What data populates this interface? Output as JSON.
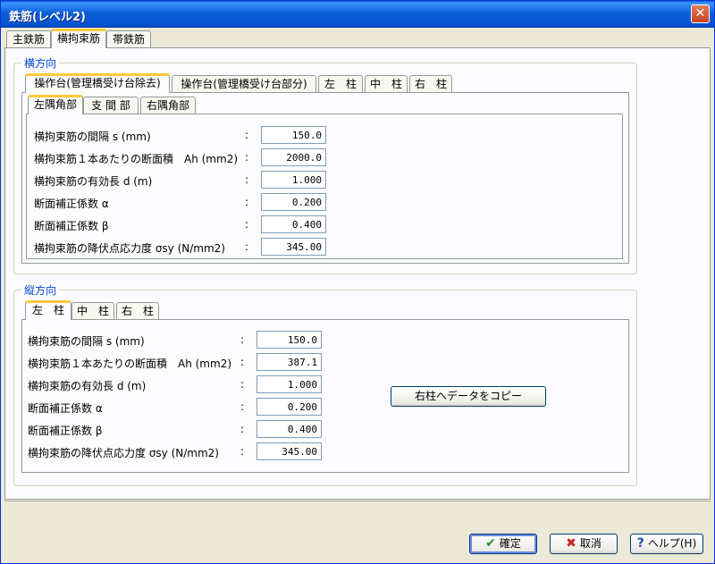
{
  "window": {
    "title": "鉄筋(レベル2)",
    "close_label": "✕"
  },
  "main_tabs": [
    "主鉄筋",
    "横拘束筋",
    "帯鉄筋"
  ],
  "horizontal": {
    "group_label": "横方向",
    "sub_tabs": [
      "操作台(管理橋受け台除去)",
      "操作台(管理橋受け台部分)",
      "左　柱",
      "中　柱",
      "右　柱"
    ],
    "position_tabs": [
      "左隅角部",
      "支 間 部",
      "右隅角部"
    ],
    "rows": [
      {
        "label": "横拘束筋の間隔 s (mm)",
        "value": "150.0"
      },
      {
        "label": "横拘束筋１本あたりの断面積　Ah (mm2)",
        "value": "2000.0"
      },
      {
        "label": "横拘束筋の有効長 d (m)",
        "value": "1.000"
      },
      {
        "label": "断面補正係数 α",
        "value": "0.200"
      },
      {
        "label": "断面補正係数 β",
        "value": "0.400"
      },
      {
        "label": "横拘束筋の降伏点応力度 σsy (N/mm2)",
        "value": "345.00"
      }
    ]
  },
  "vertical": {
    "group_label": "縦方向",
    "sub_tabs": [
      "左　柱",
      "中　柱",
      "右　柱"
    ],
    "rows": [
      {
        "label": "横拘束筋の間隔 s (mm)",
        "value": "150.0"
      },
      {
        "label": "横拘束筋１本あたりの断面積　Ah (mm2)",
        "value": "387.1"
      },
      {
        "label": "横拘束筋の有効長 d (m)",
        "value": "1.000"
      },
      {
        "label": "断面補正係数 α",
        "value": "0.200"
      },
      {
        "label": "断面補正係数 β",
        "value": "0.400"
      },
      {
        "label": "横拘束筋の降伏点応力度 σsy (N/mm2)",
        "value": "345.00"
      }
    ],
    "copy_button": "右柱へデータをコピー"
  },
  "footer": {
    "confirm": "確定",
    "cancel": "取消",
    "help": "ヘルプ(H)"
  },
  "colon": ":"
}
